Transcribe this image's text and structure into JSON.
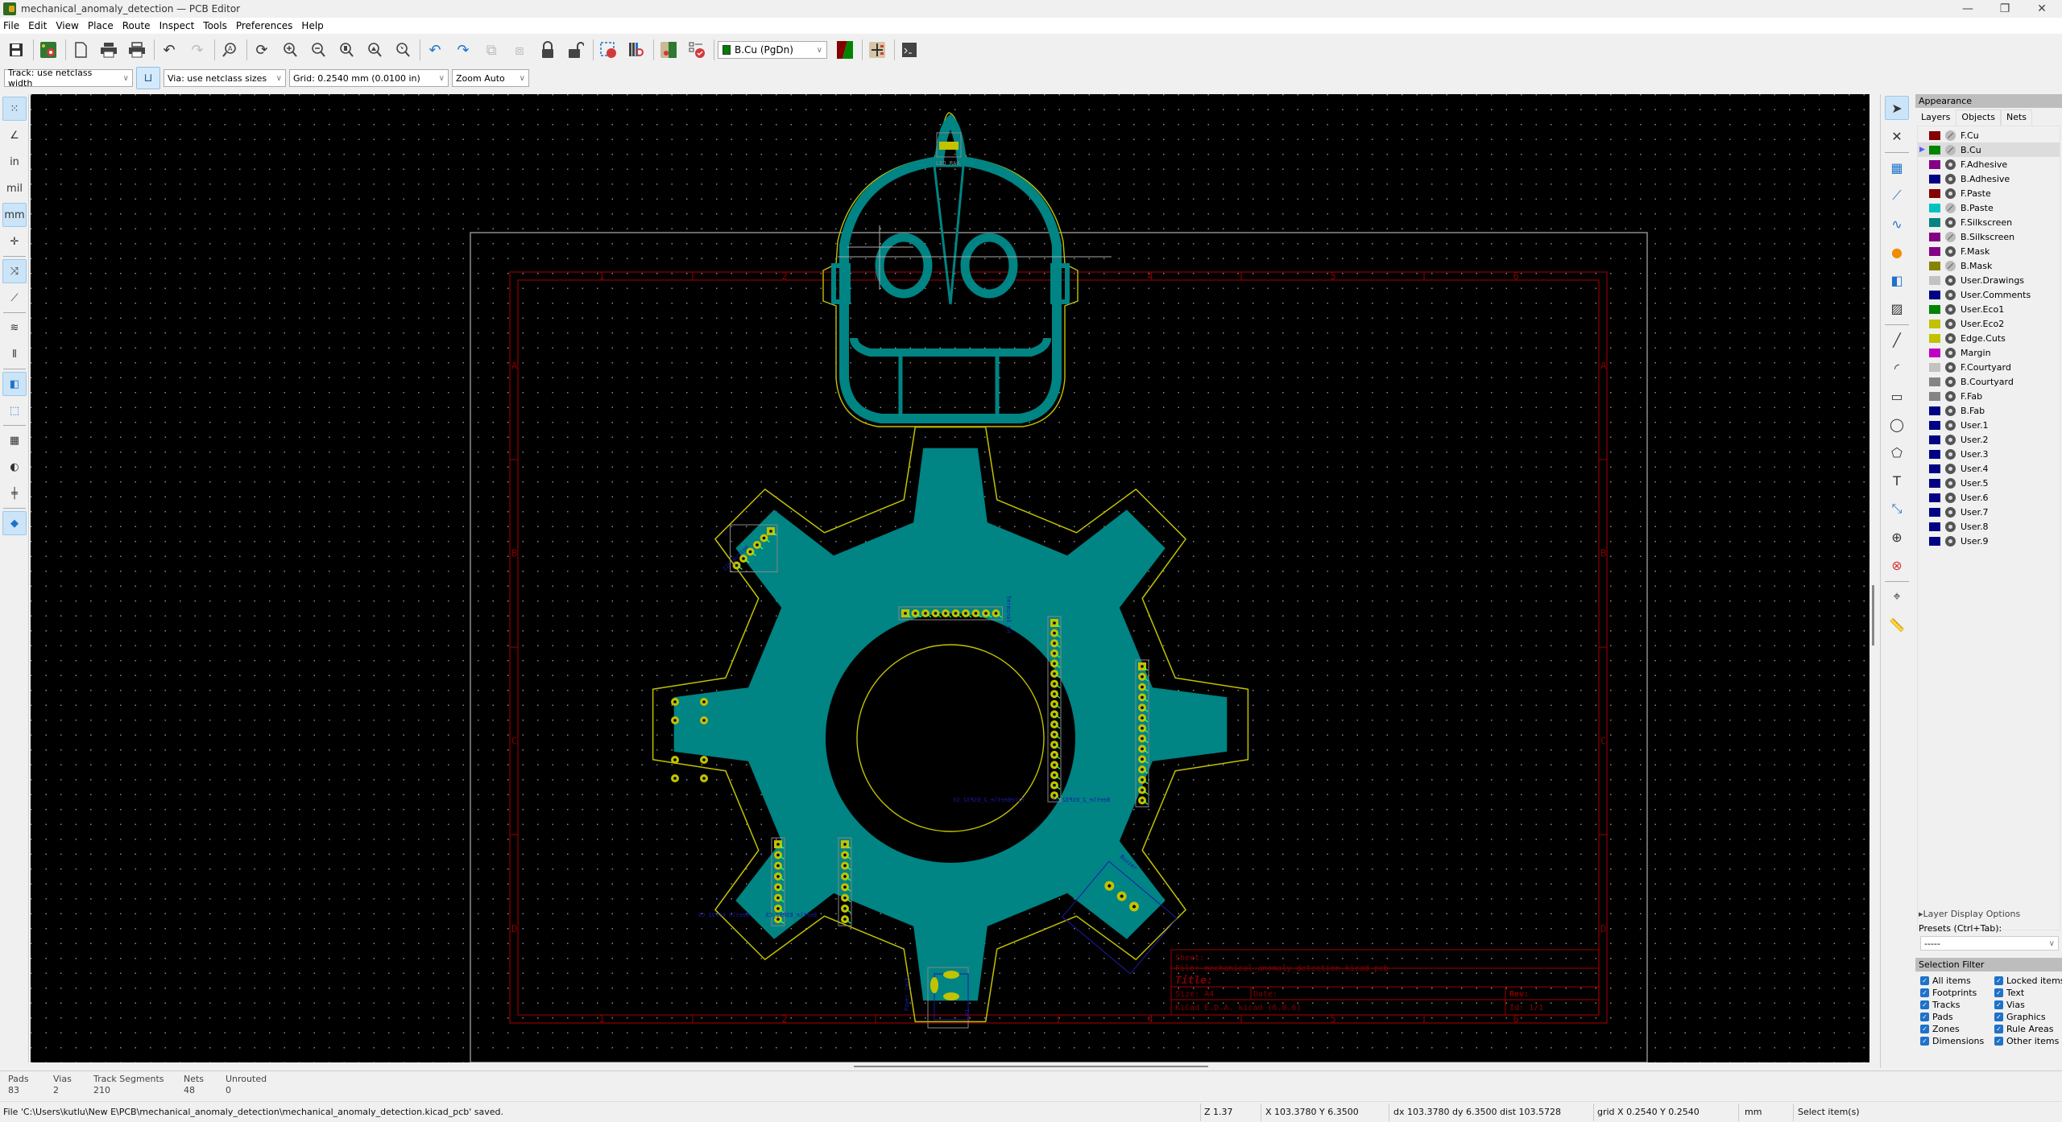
{
  "window": {
    "title": "mechanical_anomaly_detection — PCB Editor",
    "controls": {
      "minimize": "—",
      "restore": "❐",
      "close": "✕"
    }
  },
  "menu": [
    "File",
    "Edit",
    "View",
    "Place",
    "Route",
    "Inspect",
    "Tools",
    "Preferences",
    "Help"
  ],
  "toolbar": {
    "buttons": [
      {
        "name": "save",
        "icon": "save-icon"
      },
      {
        "name": "board-setup",
        "icon": "board-setup-icon"
      },
      {
        "name": "page-settings",
        "icon": "page-icon"
      },
      {
        "name": "print",
        "icon": "print-icon"
      },
      {
        "name": "plot",
        "icon": "plot-icon"
      },
      {
        "name": "undo",
        "icon": "undo-icon"
      },
      {
        "name": "redo",
        "icon": "redo-icon"
      },
      {
        "name": "find",
        "icon": "find-icon"
      },
      {
        "name": "redraw",
        "icon": "refresh-icon"
      },
      {
        "name": "zoom-in",
        "icon": "zoom-in-icon"
      },
      {
        "name": "zoom-out",
        "icon": "zoom-out-icon"
      },
      {
        "name": "zoom-fit",
        "icon": "zoom-fit-icon"
      },
      {
        "name": "zoom-fit-objects",
        "icon": "zoom-objects-icon"
      },
      {
        "name": "zoom-selection",
        "icon": "zoom-selection-icon"
      },
      {
        "name": "rotate-ccw",
        "icon": "rotate-ccw-icon"
      },
      {
        "name": "rotate-cw",
        "icon": "rotate-cw-icon"
      },
      {
        "name": "group",
        "icon": "group-icon"
      },
      {
        "name": "ungroup",
        "icon": "ungroup-icon"
      },
      {
        "name": "lock",
        "icon": "lock-icon"
      },
      {
        "name": "unlock",
        "icon": "unlock-icon"
      },
      {
        "name": "footprint-editor",
        "icon": "footprint-editor-icon"
      },
      {
        "name": "footprint-browser",
        "icon": "footprint-browser-icon"
      },
      {
        "name": "update-from-schematic",
        "icon": "update-pcb-icon"
      },
      {
        "name": "drc",
        "icon": "drc-icon"
      },
      {
        "name": "layer-pair",
        "icon": "layer-pair-icon"
      },
      {
        "name": "schematic",
        "icon": "schematic-icon"
      },
      {
        "name": "scripting-console",
        "icon": "console-icon"
      }
    ],
    "active_layer": "B.Cu (PgDn)",
    "active_layer_color": "#008000"
  },
  "toolbar2": {
    "track_width": "Track: use netclass width",
    "via_size": "Via: use netclass sizes",
    "grid": "Grid: 0.2540 mm (0.0100 in)",
    "zoom": "Zoom Auto"
  },
  "left_toolbar": [
    {
      "name": "grid-toggle",
      "icon": "grid-icon",
      "active": true,
      "glyph": "⁙"
    },
    {
      "name": "polar-coords",
      "icon": "polar-coords-icon",
      "active": false,
      "glyph": "∠"
    },
    {
      "name": "units-inches",
      "icon": "inch-icon",
      "active": false,
      "glyph": "in"
    },
    {
      "name": "units-mils",
      "icon": "mil-icon",
      "active": false,
      "glyph": "mil"
    },
    {
      "name": "units-mm",
      "icon": "mm-icon",
      "active": true,
      "glyph": "mm"
    },
    {
      "name": "full-crosshair",
      "icon": "crosshair-icon",
      "active": false,
      "glyph": "✛"
    },
    {
      "name": "ratsnest",
      "icon": "ratsnest-icon",
      "active": true,
      "glyph": "⤨"
    },
    {
      "name": "curved-ratsnest",
      "icon": "curved-ratsnest-icon",
      "active": false,
      "glyph": "⟋"
    },
    {
      "name": "high-contrast",
      "icon": "contrast-icon",
      "active": false,
      "glyph": "≋"
    },
    {
      "name": "net-inspector",
      "icon": "net-icon",
      "active": false,
      "glyph": "⫴"
    },
    {
      "name": "show-pads-fill",
      "icon": "pad-icon",
      "active": true,
      "glyph": "◧"
    },
    {
      "name": "show-pads-outline",
      "icon": "pad-outline-icon",
      "active": false,
      "glyph": "⬚"
    },
    {
      "name": "show-footprint-text",
      "icon": "footprint-icon",
      "active": false,
      "glyph": "▦"
    },
    {
      "name": "show-vias",
      "icon": "via-icon",
      "active": false,
      "glyph": "◐"
    },
    {
      "name": "show-tracks",
      "icon": "track-icon",
      "active": false,
      "glyph": "╪"
    },
    {
      "name": "layers-manager",
      "icon": "layers-icon",
      "active": true,
      "glyph": "◆"
    }
  ],
  "right_toolbar": [
    {
      "name": "select",
      "icon": "cursor-icon",
      "active": true,
      "glyph": "➤"
    },
    {
      "name": "local-ratsnest",
      "icon": "ratsnest-icon",
      "glyph": "✕"
    },
    {
      "name": "add-footprint",
      "icon": "footprint-icon",
      "glyph": "▦"
    },
    {
      "name": "route-track",
      "icon": "route-icon",
      "glyph": "⟋"
    },
    {
      "name": "tune-length",
      "icon": "tune-icon",
      "glyph": "∿"
    },
    {
      "name": "add-via",
      "icon": "via-icon",
      "glyph": "●"
    },
    {
      "name": "add-zone",
      "icon": "zone-icon",
      "glyph": "◧"
    },
    {
      "name": "add-rule-area",
      "icon": "rule-area-icon",
      "glyph": "▨"
    },
    {
      "name": "draw-line",
      "icon": "line-icon",
      "glyph": "╱"
    },
    {
      "name": "draw-arc",
      "icon": "arc-icon",
      "glyph": "◜"
    },
    {
      "name": "draw-rectangle",
      "icon": "rectangle-icon",
      "glyph": "▭"
    },
    {
      "name": "draw-circle",
      "icon": "circle-icon",
      "glyph": "◯"
    },
    {
      "name": "draw-polygon",
      "icon": "polygon-icon",
      "glyph": "⬠"
    },
    {
      "name": "add-text",
      "icon": "text-icon",
      "glyph": "T"
    },
    {
      "name": "add-dimension",
      "icon": "dimension-icon",
      "glyph": "⤡"
    },
    {
      "name": "add-target",
      "icon": "target-icon",
      "glyph": "⊕"
    },
    {
      "name": "delete",
      "icon": "delete-icon",
      "glyph": "⊗"
    },
    {
      "name": "place-origin",
      "icon": "origin-icon",
      "glyph": "⌖"
    },
    {
      "name": "measure",
      "icon": "ruler-icon",
      "glyph": "📏"
    }
  ],
  "appearance": {
    "title": "Appearance",
    "tabs": [
      "Layers",
      "Objects",
      "Nets"
    ],
    "active_tab": "Layers",
    "layers": [
      {
        "name": "F.Cu",
        "color": "#840000",
        "visible": false
      },
      {
        "name": "B.Cu",
        "color": "#008400",
        "visible": false,
        "selected": true
      },
      {
        "name": "F.Adhesive",
        "color": "#840084",
        "visible": true
      },
      {
        "name": "B.Adhesive",
        "color": "#000084",
        "visible": true
      },
      {
        "name": "F.Paste",
        "color": "#840000",
        "visible": true
      },
      {
        "name": "B.Paste",
        "color": "#00c2c2",
        "visible": false
      },
      {
        "name": "F.Silkscreen",
        "color": "#008484",
        "visible": true
      },
      {
        "name": "B.Silkscreen",
        "color": "#840084",
        "visible": false
      },
      {
        "name": "F.Mask",
        "color": "#840084",
        "visible": true
      },
      {
        "name": "B.Mask",
        "color": "#848400",
        "visible": false
      },
      {
        "name": "User.Drawings",
        "color": "#c2c2c2",
        "visible": true
      },
      {
        "name": "User.Comments",
        "color": "#000084",
        "visible": true
      },
      {
        "name": "User.Eco1",
        "color": "#008400",
        "visible": true
      },
      {
        "name": "User.Eco2",
        "color": "#c2c200",
        "visible": true
      },
      {
        "name": "Edge.Cuts",
        "color": "#c2c200",
        "visible": true
      },
      {
        "name": "Margin",
        "color": "#c200c2",
        "visible": true
      },
      {
        "name": "F.Courtyard",
        "color": "#c2c2c2",
        "visible": true
      },
      {
        "name": "B.Courtyard",
        "color": "#848484",
        "visible": true
      },
      {
        "name": "F.Fab",
        "color": "#848484",
        "visible": true
      },
      {
        "name": "B.Fab",
        "color": "#000084",
        "visible": true
      },
      {
        "name": "User.1",
        "color": "#000084",
        "visible": true
      },
      {
        "name": "User.2",
        "color": "#000084",
        "visible": true
      },
      {
        "name": "User.3",
        "color": "#000084",
        "visible": true
      },
      {
        "name": "User.4",
        "color": "#000084",
        "visible": true
      },
      {
        "name": "User.5",
        "color": "#000084",
        "visible": true
      },
      {
        "name": "User.6",
        "color": "#000084",
        "visible": true
      },
      {
        "name": "User.7",
        "color": "#000084",
        "visible": true
      },
      {
        "name": "User.8",
        "color": "#000084",
        "visible": true
      },
      {
        "name": "User.9",
        "color": "#000084",
        "visible": true
      }
    ],
    "layer_display_options": "Layer Display Options",
    "presets_label": "Presets (Ctrl+Tab):",
    "presets_value": "-----"
  },
  "selection_filter": {
    "title": "Selection Filter",
    "items": [
      {
        "label": "All items",
        "checked": true
      },
      {
        "label": "Locked items",
        "checked": true
      },
      {
        "label": "Footprints",
        "checked": true
      },
      {
        "label": "Text",
        "checked": true
      },
      {
        "label": "Tracks",
        "checked": true
      },
      {
        "label": "Vias",
        "checked": true
      },
      {
        "label": "Pads",
        "checked": true
      },
      {
        "label": "Graphics",
        "checked": true
      },
      {
        "label": "Zones",
        "checked": true
      },
      {
        "label": "Rule Areas",
        "checked": true
      },
      {
        "label": "Dimensions",
        "checked": true
      },
      {
        "label": "Other items",
        "checked": true
      }
    ]
  },
  "board": {
    "colors": {
      "copper_zone": "#008484",
      "edge_cuts": "#c2c200",
      "pads": "#c2c200",
      "worksheet": "#840000",
      "page_frame": "#8c8c8c",
      "fab": "#000084",
      "ratsnest": "#4cff4c"
    },
    "title_block": {
      "sheet": "Sheet:",
      "file": "File: mechanical_anomaly_detection.kicad_pcb",
      "title": "Title:",
      "size": "Size: A4",
      "date": "Date:",
      "rev": "Rev:",
      "kicad": "KiCad E.D.A.  kicad (6.0.6)",
      "id": "Id: 1/1"
    },
    "frame_column_labels": [
      "1",
      "2",
      "3",
      "4",
      "5",
      "6"
    ],
    "frame_row_labels": [
      "A",
      "B",
      "C",
      "D"
    ],
    "footprint_labels": {
      "led": "LED_RAG",
      "terminal": "Terminal_CH",
      "firebeetle": "FireBeetle_2_ESP32_S3",
      "beetle_s3": "Beetle_2_ESP32_S3",
      "beetle_c3_a": "Beetle_ESP32_C3",
      "beetle_c3_b": "Beetle_ESP32_C3",
      "power_jack": "Power_Jack",
      "p1": "P1",
      "buzzer": "Buzzer",
      "i2c": "I2C_Button"
    }
  },
  "stats": [
    {
      "label": "Pads",
      "value": "83"
    },
    {
      "label": "Vias",
      "value": "2"
    },
    {
      "label": "Track Segments",
      "value": "210"
    },
    {
      "label": "Nets",
      "value": "48"
    },
    {
      "label": "Unrouted",
      "value": "0"
    }
  ],
  "status": {
    "message": "File 'C:\\Users\\kutlu\\New E\\PCB\\mechanical_anomaly_detection\\mechanical_anomaly_detection.kicad_pcb' saved.",
    "zoom": "Z 1.37",
    "cursor": "X 103.3780  Y 6.3500",
    "delta": "dx 103.3780  dy 6.3500  dist 103.5728",
    "grid": "grid X 0.2540  Y 0.2540",
    "units": "mm",
    "mode": "Select item(s)"
  }
}
